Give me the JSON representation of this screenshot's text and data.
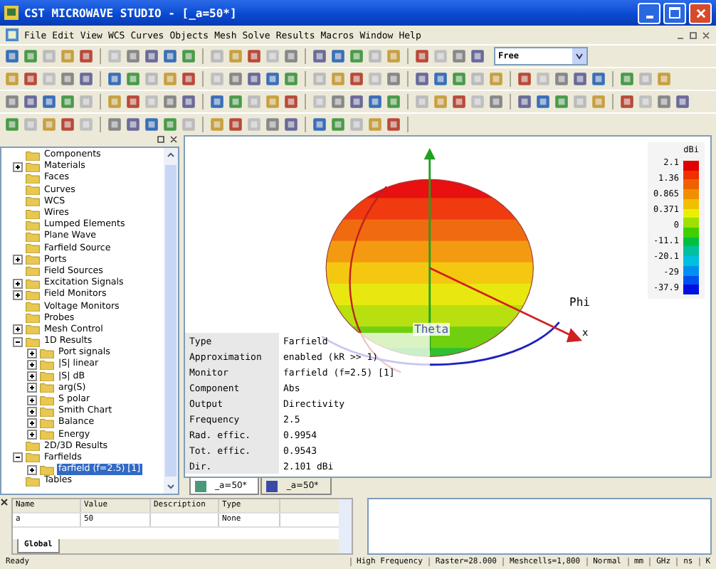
{
  "window": {
    "title": "CST MICROWAVE STUDIO - [_a=50*]"
  },
  "menu": [
    "File",
    "Edit",
    "View",
    "WCS",
    "Curves",
    "Objects",
    "Mesh",
    "Solve",
    "Results",
    "Macros",
    "Window",
    "Help"
  ],
  "toolbar": {
    "dropdown": "Free"
  },
  "tree": [
    {
      "label": "Components"
    },
    {
      "label": "Materials",
      "expanded": false
    },
    {
      "label": "Faces"
    },
    {
      "label": "Curves"
    },
    {
      "label": "WCS"
    },
    {
      "label": "Wires"
    },
    {
      "label": "Lumped Elements"
    },
    {
      "label": "Plane Wave"
    },
    {
      "label": "Farfield Source"
    },
    {
      "label": "Ports",
      "expanded": false
    },
    {
      "label": "Field Sources"
    },
    {
      "label": "Excitation Signals",
      "expanded": false
    },
    {
      "label": "Field Monitors",
      "expanded": false
    },
    {
      "label": "Voltage Monitors"
    },
    {
      "label": "Probes"
    },
    {
      "label": "Mesh Control",
      "expanded": false
    },
    {
      "label": "1D Results",
      "expanded": true,
      "children": [
        {
          "label": "Port signals",
          "expanded": false
        },
        {
          "label": "|S| linear",
          "expanded": false
        },
        {
          "label": "|S| dB",
          "expanded": false
        },
        {
          "label": "arg(S)",
          "expanded": false
        },
        {
          "label": "S polar",
          "expanded": false
        },
        {
          "label": "Smith Chart",
          "expanded": false
        },
        {
          "label": "Balance",
          "expanded": false
        },
        {
          "label": "Energy",
          "expanded": false
        }
      ]
    },
    {
      "label": "2D/3D Results"
    },
    {
      "label": "Farfields",
      "expanded": true,
      "children": [
        {
          "label": "farfield (f=2.5) [1]",
          "expanded": false,
          "selected": true
        }
      ]
    },
    {
      "label": "Tables"
    }
  ],
  "view": {
    "axes": {
      "theta": "Theta",
      "phi": "Phi",
      "x": "x"
    },
    "legend": {
      "unit": "dBi",
      "ticks": [
        "2.1",
        "1.36",
        "0.865",
        "0.371",
        "0",
        "-11.1",
        "-20.1",
        "-29",
        "-37.9"
      ]
    },
    "info": [
      [
        "Type",
        "Farfield"
      ],
      [
        "Approximation",
        "enabled (kR >> 1)"
      ],
      [
        "Monitor",
        "farfield (f=2.5) [1]"
      ],
      [
        "Component",
        "Abs"
      ],
      [
        "Output",
        "Directivity"
      ],
      [
        "Frequency",
        "2.5"
      ],
      [
        "Rad. effic.",
        "0.9954"
      ],
      [
        "Tot. effic.",
        "0.9543"
      ],
      [
        "Dir.",
        "2.101 dBi"
      ]
    ]
  },
  "doc_tabs": [
    {
      "label": "_a=50*",
      "selected": true
    },
    {
      "label": "_a=50*",
      "selected": false
    }
  ],
  "parameters": {
    "columns": [
      "Name",
      "Value",
      "Description",
      "Type"
    ],
    "rows": [
      [
        "a",
        "50",
        "",
        "None"
      ]
    ],
    "tab": "Global"
  },
  "status_bar": [
    "Ready",
    "High Frequency",
    "Raster=28.000",
    "Meshcells=1,800",
    "Normal",
    "mm",
    "GHz",
    "ns",
    "K"
  ]
}
